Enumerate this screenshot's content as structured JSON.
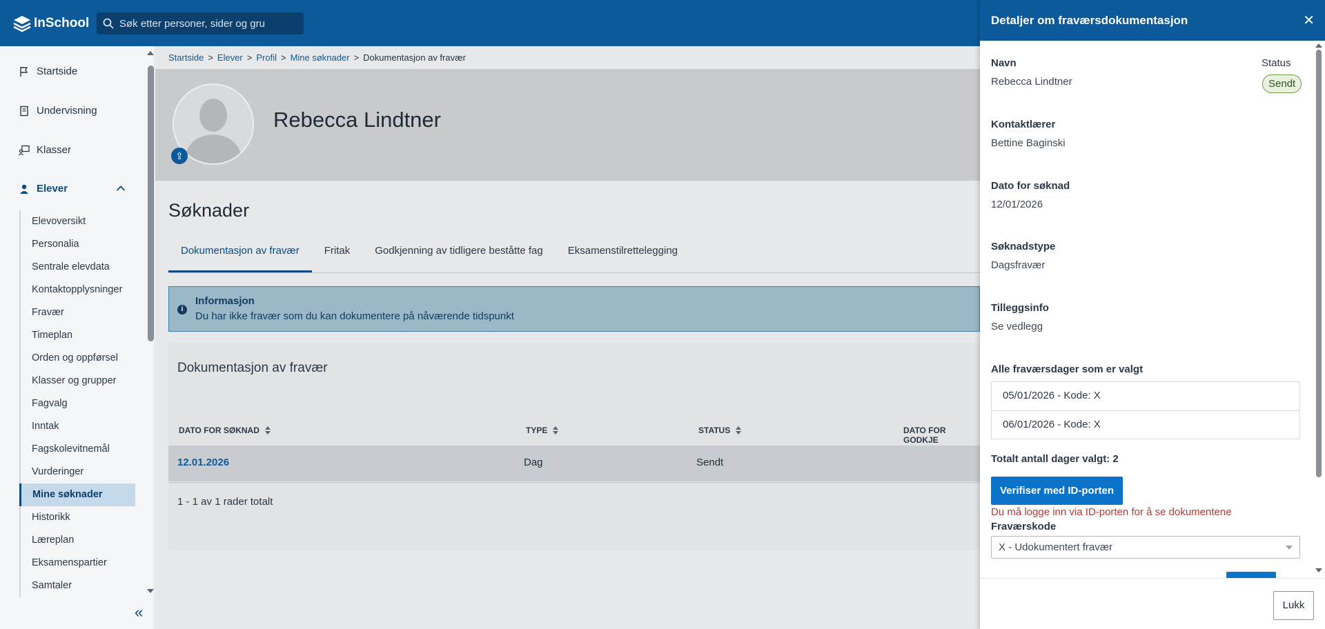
{
  "brand": {
    "name": "InSchool"
  },
  "search": {
    "placeholder": "Søk etter personer, sider og gru"
  },
  "sidebar": {
    "main_items": [
      {
        "label": "Startside",
        "icon": "flag-icon"
      },
      {
        "label": "Undervisning",
        "icon": "book-icon"
      },
      {
        "label": "Klasser",
        "icon": "classroom-icon"
      },
      {
        "label": "Elever",
        "icon": "student-icon"
      }
    ],
    "sub_items": [
      "Elevoversikt",
      "Personalia",
      "Sentrale elevdata",
      "Kontaktopplysninger",
      "Fravær",
      "Timeplan",
      "Orden og oppførsel",
      "Klasser og grupper",
      "Fagvalg",
      "Inntak",
      "Fagskolevitnemål",
      "Vurderinger",
      "Mine søknader",
      "Historikk",
      "Læreplan",
      "Eksamenspartier",
      "Samtaler"
    ],
    "active_sub": "Mine søknader"
  },
  "breadcrumb": {
    "items": [
      "Startside",
      "Elever",
      "Profil",
      "Mine søknader"
    ],
    "current": "Dokumentasjon av fravær"
  },
  "student": {
    "name": "Rebecca Lindtner"
  },
  "page": {
    "heading": "Søknader"
  },
  "tabs": [
    "Dokumentasjon av fravær",
    "Fritak",
    "Godkjenning av tidligere beståtte fag",
    "Eksamenstilrettelegging"
  ],
  "info": {
    "title": "Informasjon",
    "text": "Du har ikke fravær som du kan dokumentere på nåværende tidspunkt"
  },
  "table": {
    "title": "Dokumentasjon av fravær",
    "headers": [
      "DATO FOR SØKNAD",
      "TYPE",
      "STATUS",
      "DATO FOR GODKJE"
    ],
    "rows": [
      {
        "date": "12.01.2026",
        "type": "Dag",
        "status": "Sendt"
      }
    ],
    "footer": "1 - 1 av 1 rader totalt"
  },
  "drawer": {
    "title": "Detaljer om fraværsdokumentasjon",
    "name_label": "Navn",
    "name_value": "Rebecca Lindtner",
    "status_label": "Status",
    "status_value": "Sendt",
    "teacher_label": "Kontaktlærer",
    "teacher_value": "Bettine Baginski",
    "date_label": "Dato for søknad",
    "date_value": "12/01/2026",
    "type_label": "Søknadstype",
    "type_value": "Dagsfravær",
    "extra_label": "Tilleggsinfo",
    "extra_value": "Se vedlegg",
    "days_label": "Alle fraværsdager som er valgt",
    "days": [
      "05/01/2026 - Kode: X",
      "06/01/2026 - Kode: X"
    ],
    "total": "Totalt antall dager valgt: 2",
    "verify_label": "Verifiser med ID-porten",
    "error": "Du må logge inn via ID-porten for å se dokumentene",
    "code_label": "Fraværskode",
    "code_value": "X - Udokumentert fravær",
    "close_label": "Lukk"
  },
  "colors": {
    "primary": "#0c5a9a",
    "accent": "#0c74c8",
    "error": "#b23a34",
    "badge": "#e9f2dd"
  }
}
